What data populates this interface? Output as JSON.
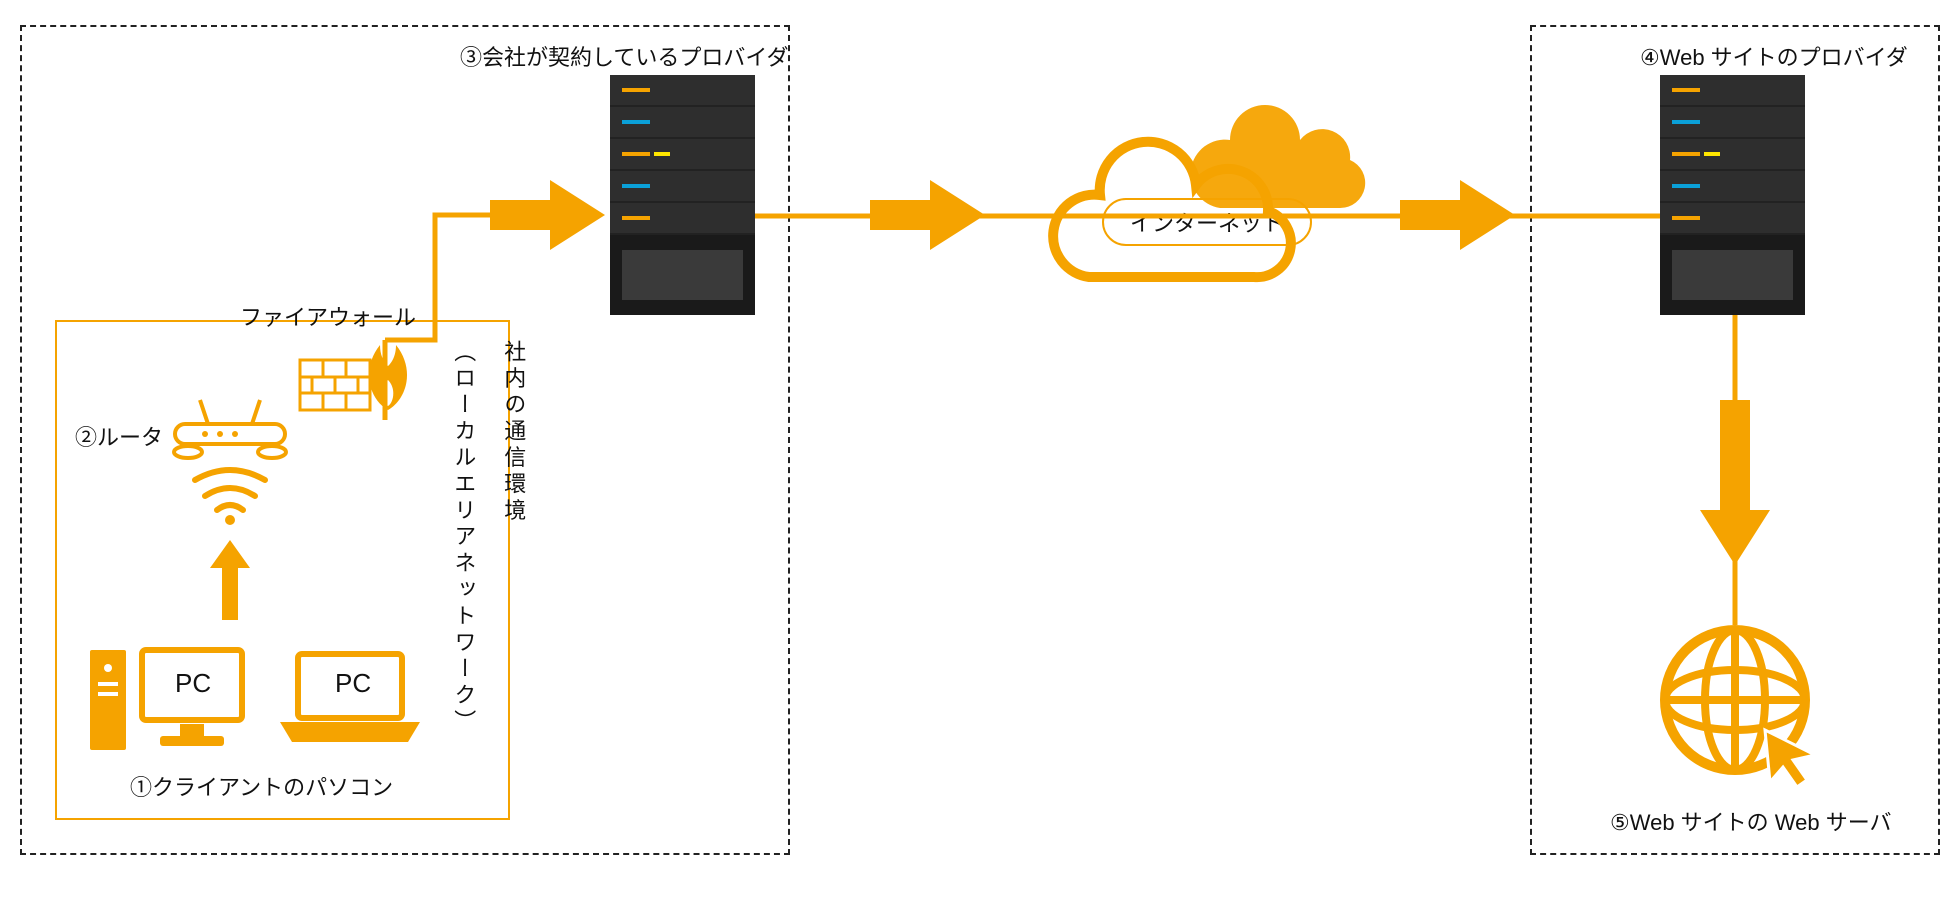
{
  "colors": {
    "accent": "#f5a300",
    "dark": "#222222"
  },
  "labels": {
    "client_pc": "①クライアントのパソコン",
    "router": "②ルータ",
    "firewall": "ファイアウォール",
    "company_provider": "③会社が契約しているプロバイダ",
    "website_provider": "④Web サイトのプロバイダ",
    "web_server": "⑤Web サイトの Web サーバ",
    "internet": "インターネット",
    "lan_line1": "社内の通信環境",
    "lan_line2": "（ローカルエリアネットワーク）",
    "pc_text": "PC"
  }
}
